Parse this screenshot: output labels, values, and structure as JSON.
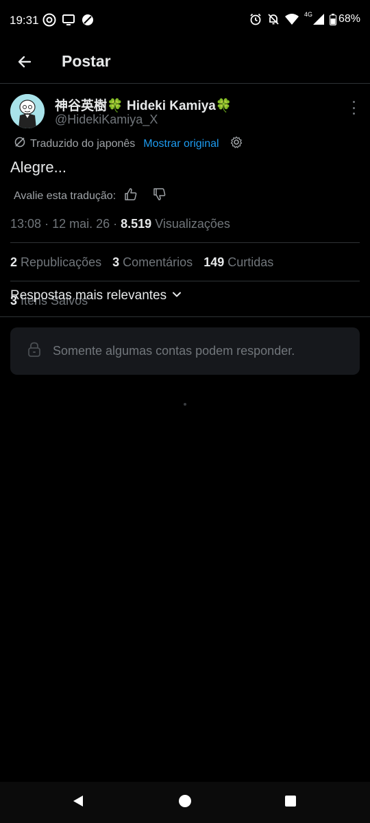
{
  "status_bar": {
    "time": "19:31",
    "network": "4G",
    "battery": "68%",
    "icons": [
      "threads-icon",
      "cast-icon",
      "blocked-icon",
      "alarm-icon",
      "bell-off-icon",
      "wifi-icon",
      "signal-icon",
      "battery-icon"
    ]
  },
  "top_bar": {
    "title": "Postar",
    "back_icon": "arrow-left-icon"
  },
  "post": {
    "author": {
      "name_jp": "神谷英樹",
      "name_en": "Hideki Kamiya",
      "clover": "🍀",
      "handle": "@HidekiKamiya_X"
    },
    "translation": {
      "label": "Traduzido do japonês",
      "show_original": "Mostrar original"
    },
    "text": "Alegre...",
    "rate": {
      "label": "Avalie esta tradução:"
    },
    "meta": {
      "time": "13:08",
      "date": "12 mai. 26",
      "views_count": "8.519",
      "views_label": "Visualizações"
    },
    "stats": {
      "reposts_count": "2",
      "reposts_label": "Republicações",
      "comments_count": "3",
      "comments_label": "Comentários",
      "likes_count": "149",
      "likes_label": "Curtidas",
      "saved_count": "3",
      "saved_label": "Itens Salvos"
    }
  },
  "replies": {
    "sort_label": "Respostas mais relevantes",
    "restricted_text": "Somente algumas contas podem responder."
  },
  "colors": {
    "background": "#000000",
    "accent": "#1d9bf0",
    "muted": "#71767b",
    "text": "#e7e9ea"
  }
}
